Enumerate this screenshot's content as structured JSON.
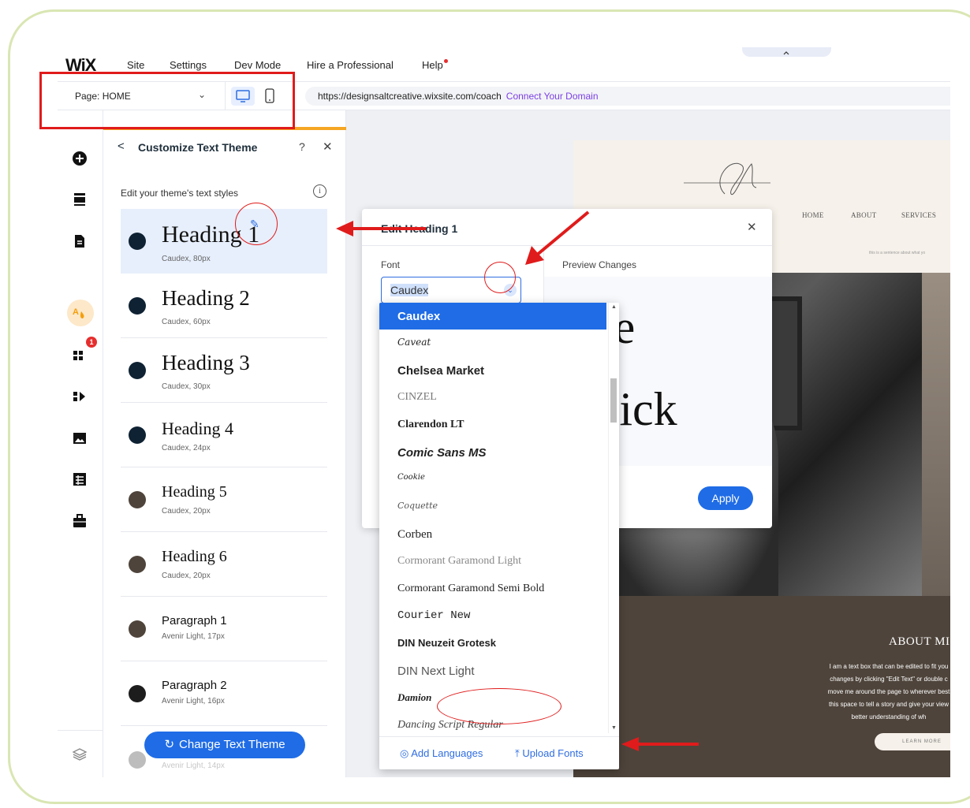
{
  "topbar": {
    "logo": "WiX",
    "menu": [
      "Site",
      "Settings",
      "Dev Mode",
      "Hire a Professional",
      "Help"
    ]
  },
  "secbar": {
    "page_label": "Page: HOME",
    "url": "https://designsaltcreative.wixsite.com/coach",
    "connect_domain": "Connect Your Domain"
  },
  "panel": {
    "title": "Customize Text Theme",
    "subtitle": "Edit your theme's text styles",
    "styles": [
      {
        "name": "Heading 1",
        "meta": "Caudex, 80px",
        "color": "#0f2233"
      },
      {
        "name": "Heading 2",
        "meta": "Caudex, 60px",
        "color": "#0f2233"
      },
      {
        "name": "Heading 3",
        "meta": "Caudex, 30px",
        "color": "#0f2233"
      },
      {
        "name": "Heading 4",
        "meta": "Caudex, 24px",
        "color": "#0f2233"
      },
      {
        "name": "Heading 5",
        "meta": "Caudex, 20px",
        "color": "#4e443b"
      },
      {
        "name": "Heading 6",
        "meta": "Caudex, 20px",
        "color": "#4e443b"
      },
      {
        "name": "Paragraph 1",
        "meta": "Avenir Light, 17px",
        "color": "#4e443b"
      },
      {
        "name": "Paragraph 2",
        "meta": "Avenir Light, 16px",
        "color": "#1d1d1d"
      },
      {
        "name": "",
        "meta": "Avenir Light, 14px",
        "color": "#bdbdbd"
      }
    ],
    "change_button": "Change Text Theme"
  },
  "dialog": {
    "title": "Edit Heading 1",
    "font_label": "Font",
    "font_value": "Caudex",
    "preview_label": "Preview Changes",
    "preview_line1": "The",
    "preview_line2": "Quick",
    "apply": "Apply"
  },
  "dropdown": {
    "fonts": [
      "Caudex",
      "Caveat",
      "Chelsea Market",
      "CINZEL",
      "Clarendon LT",
      "Comic Sans MS",
      "Cookie",
      "Coquette",
      "Corben",
      "Cormorant Garamond Light",
      "Cormorant Garamond Semi Bold",
      "Courier New",
      "DIN Neuzeit Grotesk",
      "DIN Next Light",
      "Damion",
      "Dancing Script Regular"
    ],
    "add_languages": "Add Languages",
    "upload_fonts": "Upload Fonts"
  },
  "site": {
    "nav": [
      "HOME",
      "ABOUT",
      "SERVICES"
    ],
    "tagline": "this is a sentence about what yo",
    "about_title": "ABOUT MI",
    "about_lines": [
      "I am a text box that can be edited to fit you",
      "changes by clicking \"Edit Text\" or double c",
      "move me around the page to wherever best",
      "this space to tell a story and give your view",
      "better understanding of wh"
    ],
    "learn_more": "LEARN MORE"
  },
  "colors": {
    "accent_blue": "#1f6ce6",
    "annotation_red": "#e01b1b",
    "panel_highlight": "#e7effc",
    "orange_bar": "#f5a623",
    "frame_border": "#d9e6b3"
  }
}
